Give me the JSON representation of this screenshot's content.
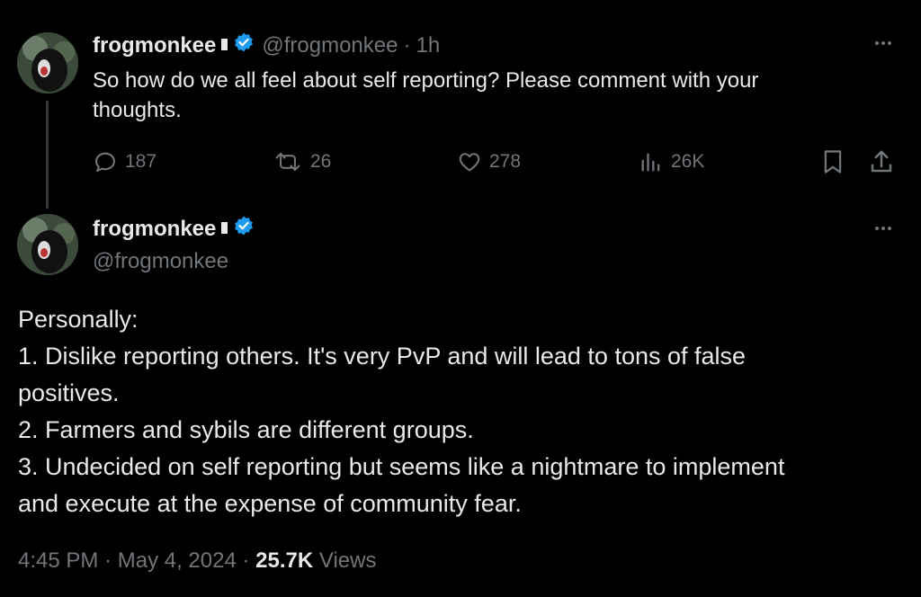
{
  "colors": {
    "background": "#000000",
    "text": "#e7e9ea",
    "muted": "#71767b",
    "verified_blue": "#1d9bf0"
  },
  "parent_tweet": {
    "display_name": "frogmonkee",
    "handle": "@frogmonkee",
    "separator": "·",
    "time_ago": "1h",
    "more_icon": "…",
    "text_line1": "So how do we all feel about self reporting? Please comment with your",
    "text_line2": "thoughts.",
    "actions": {
      "replies": "187",
      "retweets": "26",
      "likes": "278",
      "views": "26K"
    },
    "icons": [
      "reply-icon",
      "retweet-icon",
      "like-icon",
      "views-icon",
      "bookmark-icon",
      "share-icon"
    ]
  },
  "reply_tweet": {
    "display_name": "frogmonkee",
    "handle": "@frogmonkee",
    "more_icon": "…",
    "lines": [
      "Personally:",
      "1. Dislike reporting others. It's very PvP and will lead to tons of false",
      "positives.",
      "2. Farmers and sybils are different groups.",
      "3. Undecided on self reporting but seems like a nightmare to implement",
      "and execute at the expense of community fear."
    ],
    "meta": {
      "time": "4:45 PM",
      "dot1": "·",
      "date": "May 4, 2024",
      "dot2": "·",
      "views_count": "25.7K",
      "views_label": "Views"
    }
  }
}
